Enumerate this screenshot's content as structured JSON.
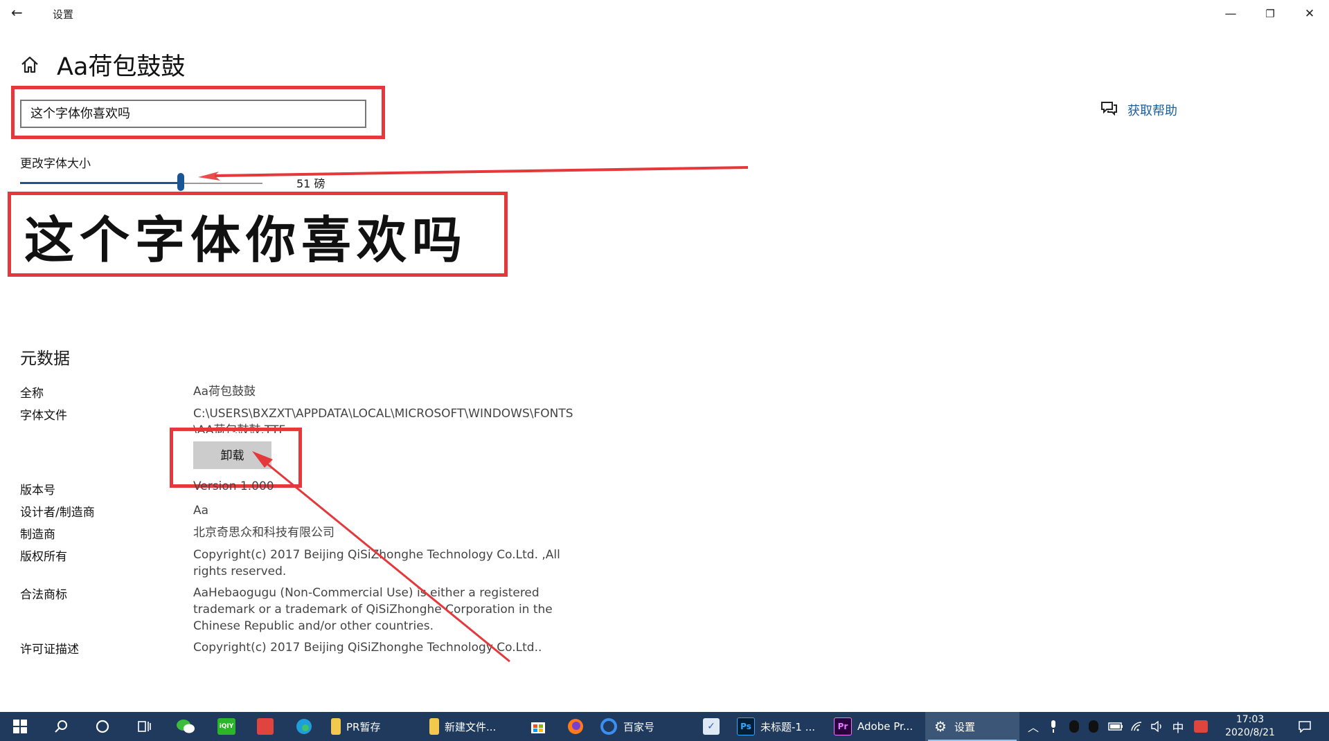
{
  "window": {
    "title": "设置",
    "minimize_glyph": "—",
    "restore_glyph": "❐",
    "close_glyph": "✕"
  },
  "header": {
    "page_title": "Aa荷包鼓鼓",
    "help_link": "获取帮助"
  },
  "preview": {
    "input_value": "这个字体你喜欢吗",
    "size_label": "更改字体大小",
    "size_value": "51 磅",
    "slider_fraction": 0.67,
    "big_text": "这个字体你喜欢吗"
  },
  "metadata": {
    "section_title": "元数据",
    "full_name_key": "全称",
    "full_name_val": "Aa荷包鼓鼓",
    "font_file_key": "字体文件",
    "font_file_val": "C:\\USERS\\BXZXT\\APPDATA\\LOCAL\\MICROSOFT\\WINDOWS\\FONTS\\AA荷包鼓鼓.TTF",
    "uninstall_label": "卸载",
    "version_key": "版本号",
    "version_val": "Version 1.000",
    "designer_key": "设计者/制造商",
    "designer_val": "Aa",
    "manufacturer_key": "制造商",
    "manufacturer_val": "北京奇思众和科技有限公司",
    "copyright_key": "版权所有",
    "copyright_val": "Copyright(c) 2017 Beijing QiSiZhonghe Technology Co.Ltd. ,All rights reserved.",
    "trademark_key": "合法商标",
    "trademark_val": "AaHebaogugu (Non-Commercial Use) is either a registered trademark or a trademark of QiSiZhonghe Corporation in the Chinese Republic and/or other countries.",
    "license_key": "许可证描述",
    "license_val": "Copyright(c) 2017 Beijing QiSiZhonghe Technology Co.Ltd.."
  },
  "taskbar": {
    "items": [
      {
        "label": "PR暂存"
      },
      {
        "label": "新建文件..."
      },
      {
        "label": "百家号"
      },
      {
        "label": "未标题-1 ..."
      },
      {
        "label": "Adobe Pr..."
      },
      {
        "label": "设置"
      }
    ],
    "ps_glyph": "Ps",
    "pr_glyph": "Pr",
    "iqiyi_glyph": "iQIY",
    "ime": "中",
    "time": "17:03",
    "date": "2020/8/21"
  },
  "colors": {
    "accent": "#1a5693",
    "annotation_red": "#e5383b",
    "taskbar": "#1f3a5c",
    "link": "#1a5fa3"
  }
}
